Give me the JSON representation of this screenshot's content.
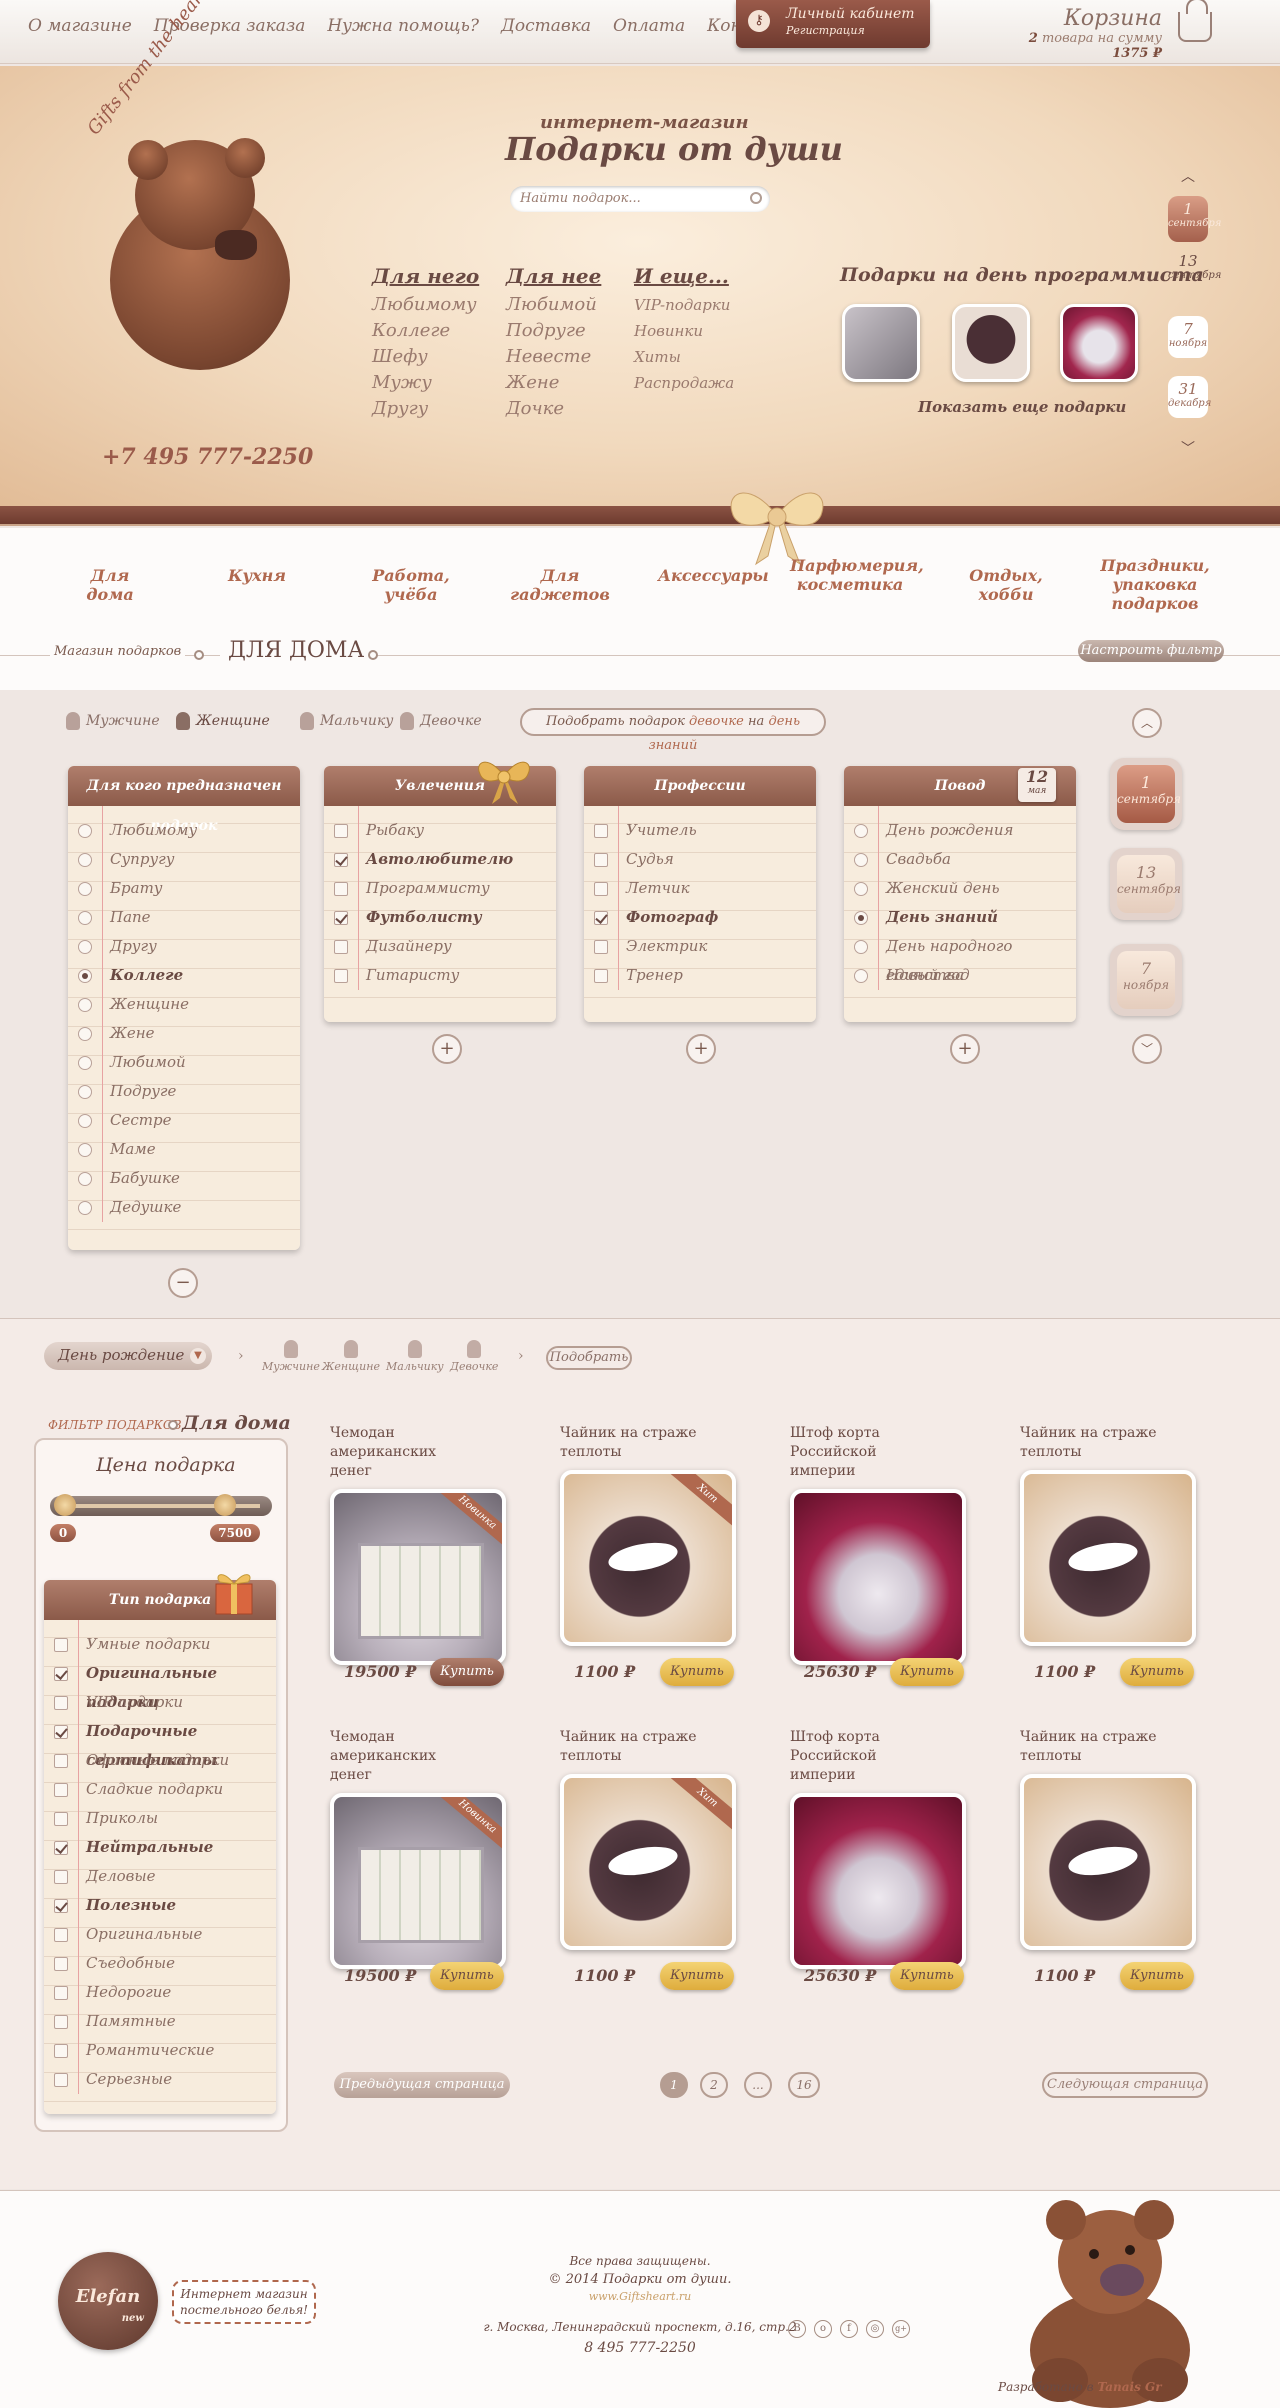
{
  "topnav": [
    "О магазине",
    "Проверка заказа",
    "Нужна помощь?",
    "Доставка",
    "Оплата",
    "Контакты"
  ],
  "cabinet": {
    "title": "Личный кабинет",
    "reg": "Регистрация"
  },
  "cart": {
    "title": "Корзина",
    "count": "2",
    "count_text": "товара на сумму",
    "sum": "1375 ₽"
  },
  "hero": {
    "arc_text": "Gifts from the heart",
    "phone": "+7 495 777-2250",
    "shop_sub": "интернет-магазин",
    "shop_title": "Подарки от души",
    "search_placeholder": "Найти подарок...",
    "col1": {
      "head": "Для него",
      "items": [
        "Любимому",
        "Коллеге",
        "Шефу",
        "Мужу",
        "Другу"
      ]
    },
    "col2": {
      "head": "Для нее",
      "items": [
        "Любимой",
        "Подруге",
        "Невесте",
        "Жене",
        "Дочке"
      ]
    },
    "col3": {
      "head": "И еще...",
      "items": [
        "VIP-подарки",
        "Новинки",
        "Хиты",
        "Распродажа"
      ]
    },
    "prog_title": "Подарки на день программиста",
    "more": "Показать еще подарки",
    "dates": [
      {
        "n": "1",
        "m": "сентября"
      },
      {
        "n": "13",
        "m": "сентября"
      },
      {
        "n": "7",
        "m": "ноября"
      },
      {
        "n": "31",
        "m": "декабря"
      }
    ]
  },
  "categories": [
    "Для дома",
    "Кухня",
    "Работа, учёба",
    "Для гаджетов",
    "Аксессуары",
    "Парфюмерия, косметика",
    "Отдых, хобби",
    "Праздники, упаковка подарков"
  ],
  "breadcrumb": {
    "shop": "Магазин подарков",
    "current": "ДЛЯ ДОМА",
    "filter_btn": "Настроить фильтр"
  },
  "genders": [
    "Мужчине",
    "Женщине",
    "Мальчику",
    "Девочке"
  ],
  "pick": {
    "pre": "Подобрать подарок",
    "who": "девочке",
    "mid": "на",
    "event": "день знаний"
  },
  "panels": {
    "who": {
      "head": "Для кого предназначен подарок",
      "items": [
        "Любимому",
        "Супругу",
        "Брату",
        "Папе",
        "Другу",
        "Коллеге",
        "Женщине",
        "Жене",
        "Любимой",
        "Подруге",
        "Сестре",
        "Маме",
        "Бабушке",
        "Дедушке"
      ],
      "selected": 5
    },
    "hobby": {
      "head": "Увлечения",
      "items": [
        "Рыбаку",
        "Автолюбителю",
        "Программисту",
        "Футболисту",
        "Дизайнеру",
        "Гитаристу"
      ],
      "checked": [
        1,
        3
      ]
    },
    "prof": {
      "head": "Профессии",
      "items": [
        "Учитель",
        "Судья",
        "Летчик",
        "Фотограф",
        "Электрик",
        "Тренер"
      ],
      "checked": [
        3
      ]
    },
    "reason": {
      "head": "Повод",
      "badge_n": "12",
      "badge_m": "мая",
      "items": [
        "День рождения",
        "Свадьба",
        "Женский день",
        "День знаний",
        "День народного единства",
        "Новый год"
      ],
      "selected": 3
    }
  },
  "side_dates": [
    {
      "n": "1",
      "m": "сентября"
    },
    {
      "n": "13",
      "m": "сентября"
    },
    {
      "n": "7",
      "m": "ноября"
    }
  ],
  "lower": {
    "day_select": "День рождение",
    "pick_btn": "Подобрать",
    "filter_shop": "ФИЛЬТР ПОДАРКОВ",
    "filter_home": "Для дома",
    "price_title": "Цена подарка",
    "price_min": "0",
    "price_max": "7500",
    "type_head": "Тип подарка",
    "types": [
      "Умные подарки",
      "Оригинальные подарки",
      "VIP подарки",
      "Подарочные сертификаты",
      "Офисные подарки",
      "Сладкие подарки",
      "Приколы",
      "Нейтральные",
      "Деловые",
      "Полезные",
      "Оригинальные",
      "Съедобные",
      "Недорогие",
      "Памятные",
      "Романтические",
      "Серьезные"
    ],
    "types_checked": [
      1,
      3,
      7,
      9
    ]
  },
  "products": [
    {
      "title": "Чемодан американских денег",
      "price": "19500 ₽",
      "img": "case",
      "ribbon": "Новинка"
    },
    {
      "title": "Чайник на страже теплоты",
      "price": "1100 ₽",
      "img": "pot",
      "ribbon": "Хит"
    },
    {
      "title": "Штоф корта Российской империи",
      "price": "25630 ₽",
      "img": "crown",
      "ribbon": ""
    },
    {
      "title": "Чайник на страже теплоты",
      "price": "1100 ₽",
      "img": "pot",
      "ribbon": ""
    },
    {
      "title": "Чемодан американских денег",
      "price": "19500 ₽",
      "img": "case",
      "ribbon": "Новинка"
    },
    {
      "title": "Чайник на страже теплоты",
      "price": "1100 ₽",
      "img": "pot",
      "ribbon": "Хит"
    },
    {
      "title": "Штоф корта Российской империи",
      "price": "25630 ₽",
      "img": "crown",
      "ribbon": ""
    },
    {
      "title": "Чайник на страже теплоты",
      "price": "1100 ₽",
      "img": "pot",
      "ribbon": ""
    }
  ],
  "buy_label": "Купить",
  "pagination": {
    "prev": "Предыдущая страница",
    "next": "Следующая страница",
    "pages": [
      "1",
      "2",
      "...",
      "16"
    ]
  },
  "footer": {
    "elefan": "Elefan",
    "elefan_sub": "new",
    "elefan_text": "Интернет магазин постельного белья!",
    "rights": "Все права защищены.",
    "copy": "© 2014 Подарки от души.",
    "site": "www.Giftsheart.ru",
    "address": "г. Москва, Ленинградский проспект, д.16, стр.2",
    "phone": "8 495 777-2250",
    "social": [
      "В",
      "о",
      "f",
      "◎",
      "g+"
    ],
    "dev_pre": "Разработано в",
    "dev_name": "Tanais Gr"
  },
  "colors": {
    "accent": "#b0684e",
    "brown": "#6a4a43",
    "gold": "#deac3c"
  }
}
